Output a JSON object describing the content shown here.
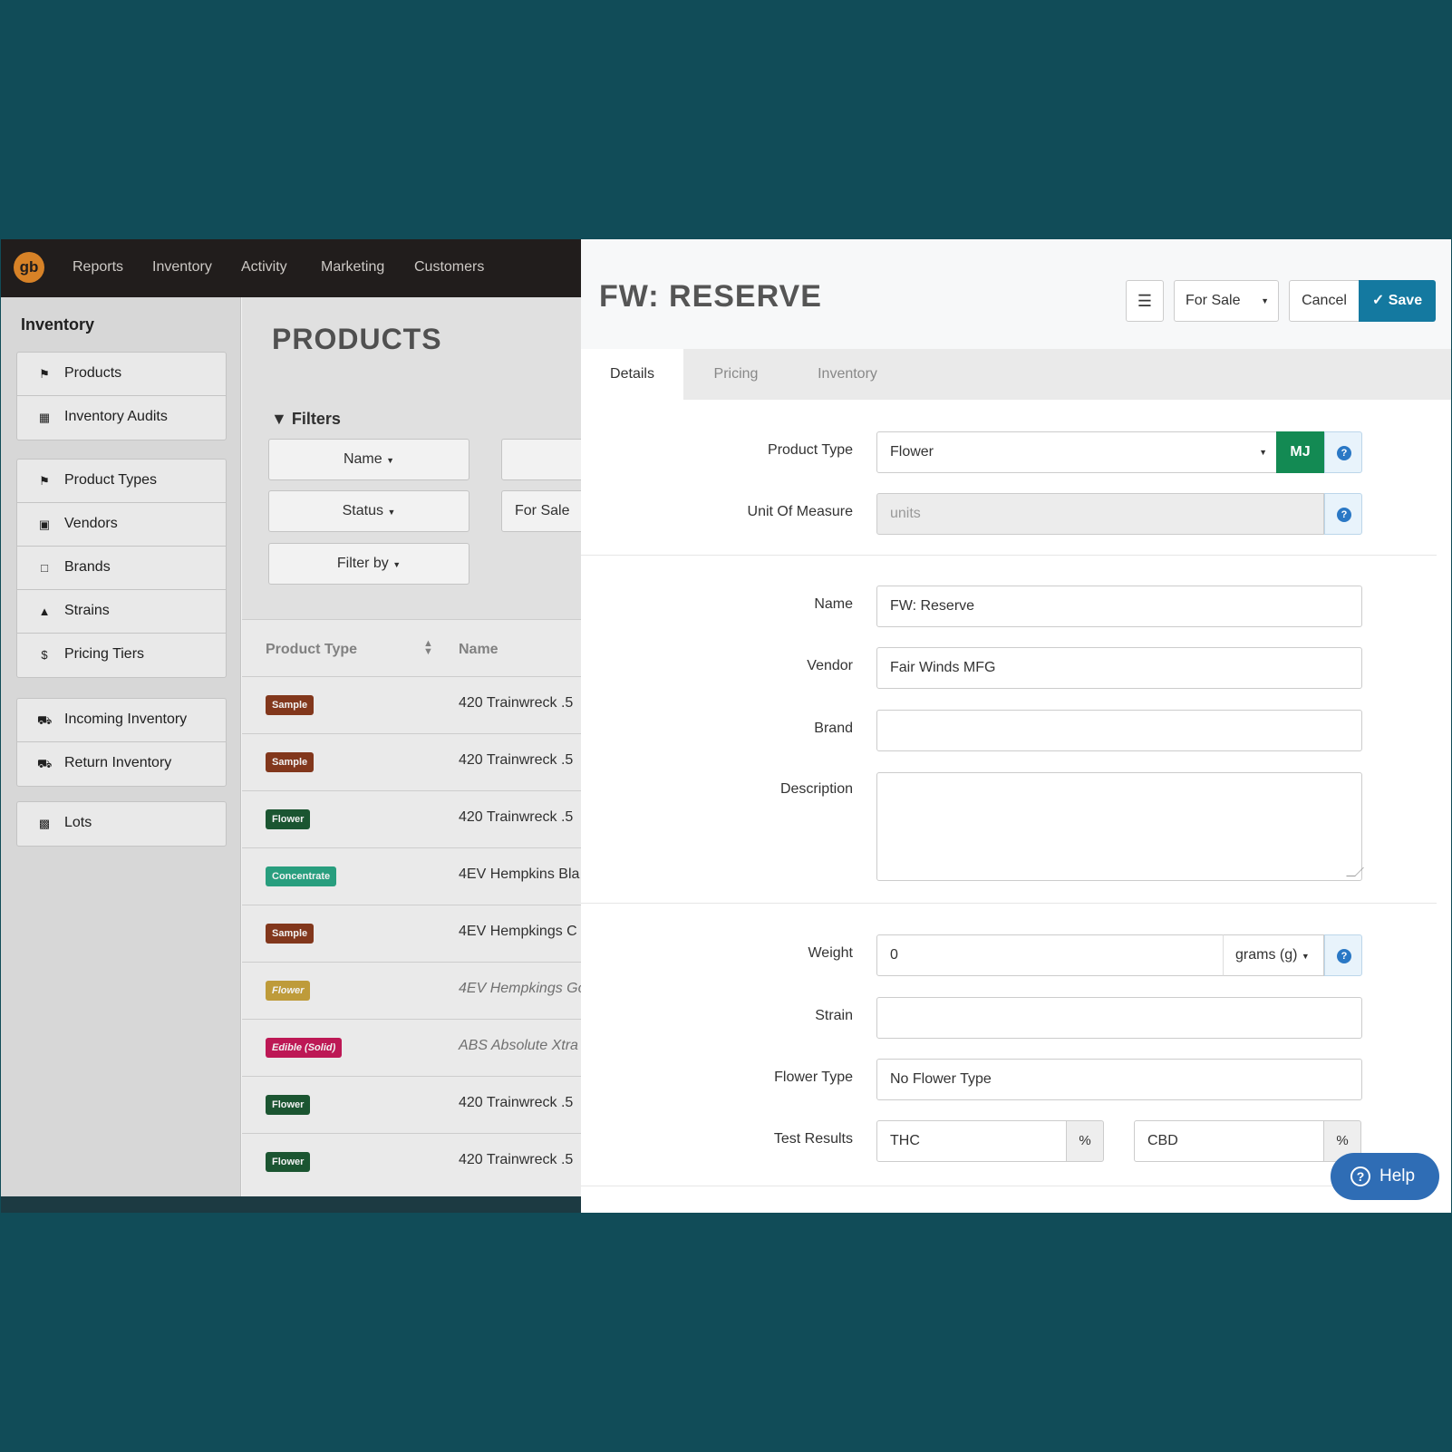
{
  "colors": {
    "background": "#114c58",
    "nav": "#231f1e",
    "accent": "#1479a0",
    "logo": "#e3892a"
  },
  "topnav": {
    "logo_text": "gb",
    "items": [
      "Reports",
      "Inventory",
      "Activity",
      "Marketing",
      "Customers"
    ]
  },
  "sidebar": {
    "title": "Inventory",
    "items": [
      {
        "label": "Products",
        "icon": "tags-icon"
      },
      {
        "label": "Inventory Audits",
        "icon": "cubes-icon"
      },
      {
        "label": "Product Types",
        "icon": "flag-icon"
      },
      {
        "label": "Vendors",
        "icon": "archive-icon"
      },
      {
        "label": "Brands",
        "icon": "bookmark-icon"
      },
      {
        "label": "Strains",
        "icon": "tree-icon"
      },
      {
        "label": "Pricing Tiers",
        "icon": "dollar-icon"
      },
      {
        "label": "Incoming Inventory",
        "icon": "truck-icon"
      },
      {
        "label": "Return Inventory",
        "icon": "truck-return-icon"
      },
      {
        "label": "Lots",
        "icon": "cube-icon"
      }
    ]
  },
  "main": {
    "title": "PRODUCTS",
    "filters_label": "Filters",
    "filters": {
      "name": "Name",
      "status": "Status",
      "filter_by": "Filter by",
      "status_value": "For Sale"
    },
    "table": {
      "headers": [
        "Product Type",
        "Name"
      ],
      "rows": [
        {
          "type": "Sample",
          "type_color": "#8a3a1e",
          "name": "420 Trainwreck .5",
          "italic": false
        },
        {
          "type": "Sample",
          "type_color": "#8a3a1e",
          "name": "420 Trainwreck .5",
          "italic": false
        },
        {
          "type": "Flower",
          "type_color": "#1d5a34",
          "name": "420 Trainwreck .5",
          "italic": false
        },
        {
          "type": "Concentrate",
          "type_color": "#2ba785",
          "name": "4EV Hempkins Bla",
          "italic": false
        },
        {
          "type": "Sample",
          "type_color": "#8a3a1e",
          "name": "4EV Hempkings C",
          "italic": false
        },
        {
          "type": "Flower",
          "type_color": "#c9a43e",
          "name": "4EV Hempkings Go",
          "italic": true
        },
        {
          "type": "Edible (Solid)",
          "type_color": "#c81a5a",
          "name": "ABS Absolute Xtra",
          "italic": true
        },
        {
          "type": "Flower",
          "type_color": "#1d5a34",
          "name": "420 Trainwreck .5",
          "italic": false
        },
        {
          "type": "Flower",
          "type_color": "#1d5a34",
          "name": "420 Trainwreck .5",
          "italic": false
        }
      ]
    }
  },
  "panel": {
    "title": "FW: RESERVE",
    "status_select": "For Sale",
    "cancel_label": "Cancel",
    "save_label": "Save",
    "tabs": [
      "Details",
      "Pricing",
      "Inventory"
    ],
    "fields": {
      "product_type": {
        "label": "Product Type",
        "value": "Flower",
        "badge": "MJ"
      },
      "unit_of_measure": {
        "label": "Unit Of Measure",
        "placeholder": "units"
      },
      "name": {
        "label": "Name",
        "value": "FW: Reserve"
      },
      "vendor": {
        "label": "Vendor",
        "value": "Fair Winds MFG"
      },
      "brand": {
        "label": "Brand",
        "value": ""
      },
      "description": {
        "label": "Description",
        "value": ""
      },
      "weight": {
        "label": "Weight",
        "value": "0",
        "unit": "grams (g)"
      },
      "strain": {
        "label": "Strain",
        "value": ""
      },
      "flower_type": {
        "label": "Flower Type",
        "value": "No Flower Type"
      },
      "test_results": {
        "label": "Test Results",
        "thc_placeholder": "THC",
        "cbd_placeholder": "CBD",
        "unit": "%"
      }
    },
    "help_label": "Help"
  }
}
